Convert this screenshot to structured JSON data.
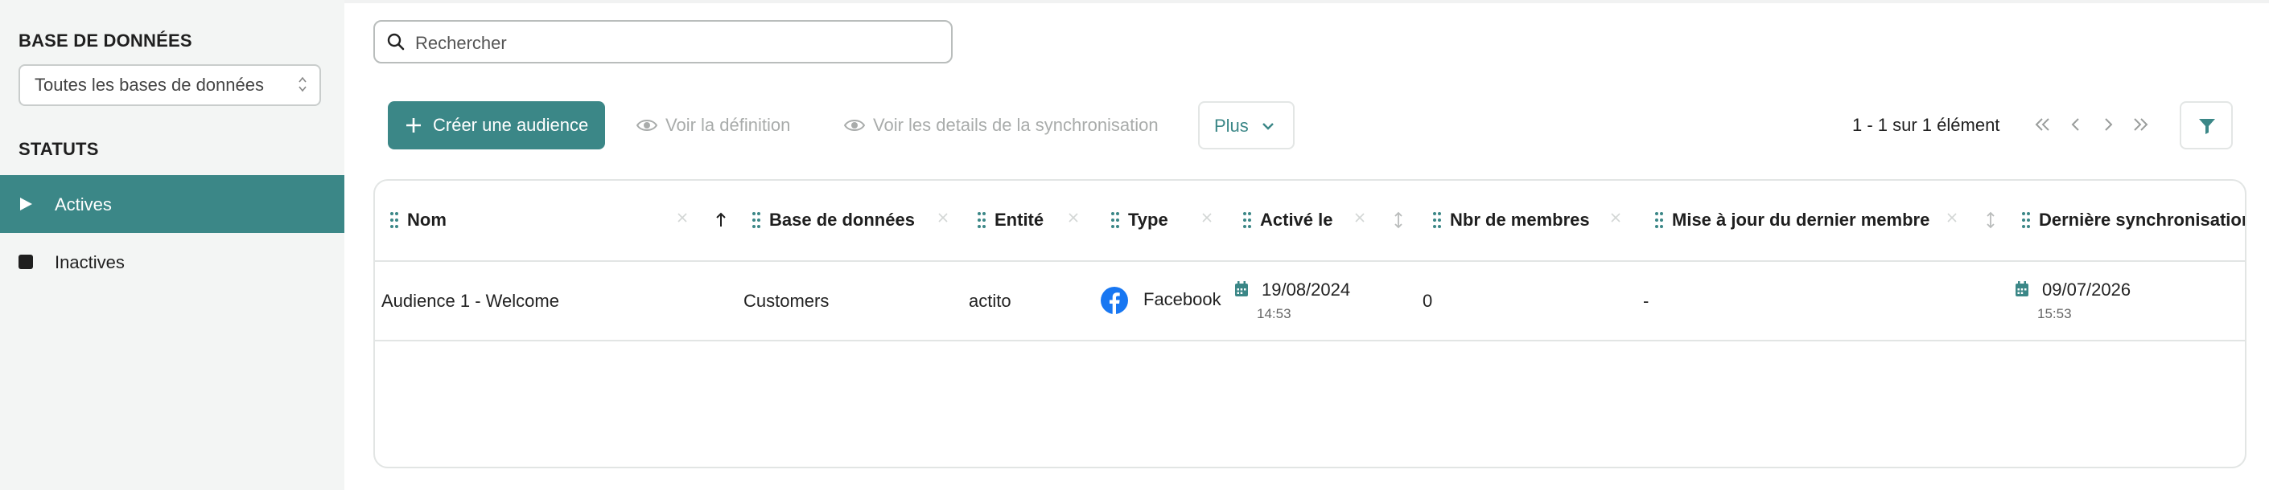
{
  "sidebar": {
    "database_heading": "BASE DE DONNÉES",
    "database_select": "Toutes les bases de données",
    "status_heading": "STATUTS",
    "items": [
      {
        "label": "Actives",
        "icon": "play-icon",
        "active": true
      },
      {
        "label": "Inactives",
        "icon": "stop-icon",
        "active": false
      }
    ]
  },
  "search": {
    "placeholder": "Rechercher",
    "value": ""
  },
  "toolbar": {
    "create_label": "Créer une audience",
    "view_definition_label": "Voir la définition",
    "view_sync_label": "Voir les details de la synchronisation",
    "more_label": "Plus"
  },
  "pagination": {
    "summary": "1 - 1 sur 1 élément"
  },
  "colors": {
    "accent": "#3b8787",
    "disabled": "#a9acab",
    "facebook": "#1877f2"
  },
  "table": {
    "columns": [
      "Nom",
      "Base de données",
      "Entité",
      "Type",
      "Activé le",
      "Nbr de membres",
      "Mise à jour du dernier membre",
      "Dernière synchronisation"
    ],
    "rows": [
      {
        "name": "Audience 1 - Welcome",
        "database": "Customers",
        "entity": "actito",
        "type": "Facebook",
        "activated_date": "19/08/2024",
        "activated_time": "14:53",
        "members": "0",
        "last_member_update": "-",
        "last_sync_date": "09/07/2026",
        "last_sync_time": "15:53"
      }
    ]
  }
}
